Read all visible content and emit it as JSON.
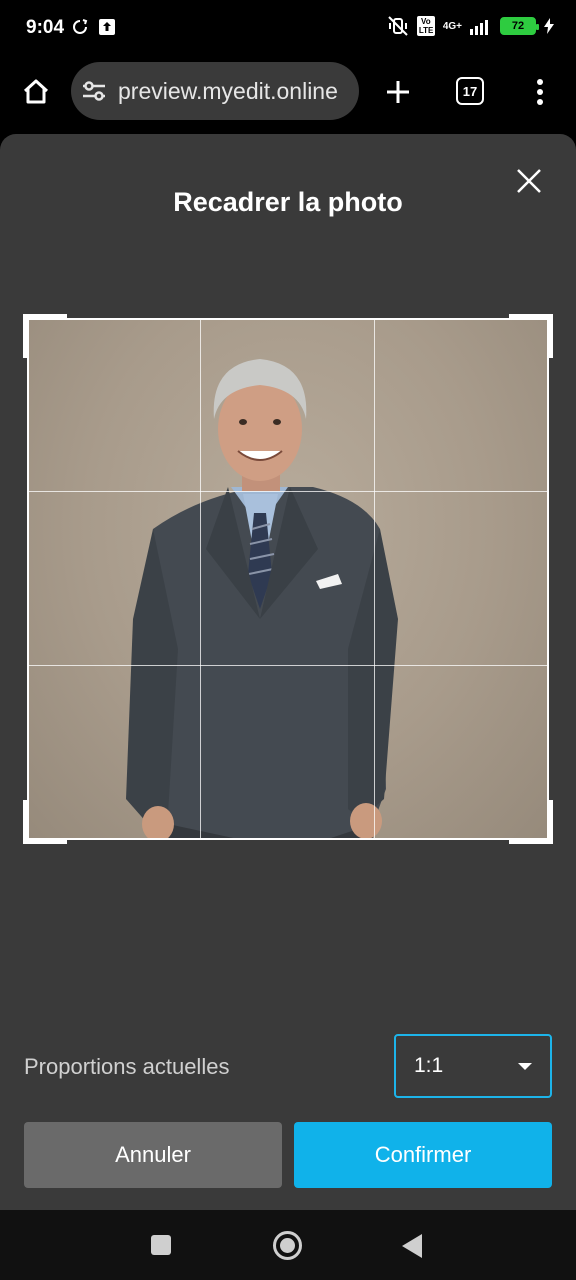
{
  "status_bar": {
    "time": "9:04",
    "network_label": "4G+",
    "volte_label": "Vo LTE",
    "battery_level": "72"
  },
  "browser": {
    "url": "preview.myedit.online",
    "tab_count": "17"
  },
  "dialog": {
    "title": "Recadrer la photo",
    "aspect_label": "Proportions actuelles",
    "aspect_value": "1:1",
    "cancel_label": "Annuler",
    "confirm_label": "Confirmer"
  },
  "icons": {
    "home": "home-icon",
    "site_settings": "tune-icon",
    "new_tab": "plus-icon",
    "menu": "more-vert-icon",
    "close": "close-icon",
    "dropdown": "caret-down-icon"
  },
  "colors": {
    "accent": "#10b2ea",
    "dialog_bg": "#3a3a3a",
    "cancel_bg": "#6a6a6a",
    "battery": "#2ecc40"
  }
}
